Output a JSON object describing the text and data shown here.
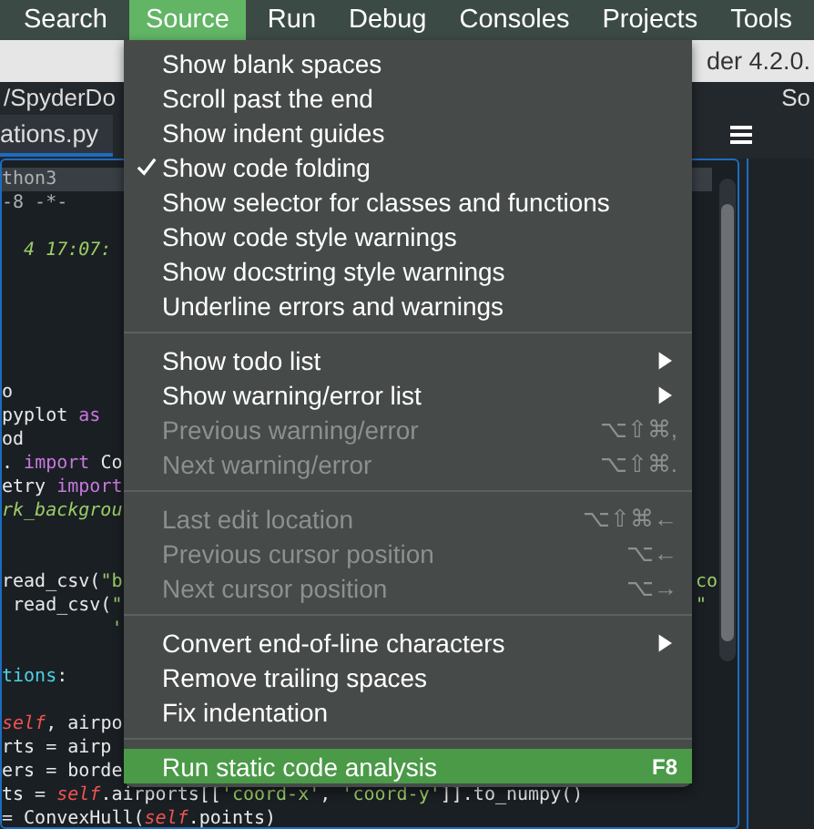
{
  "menubar": [
    {
      "label": "Search",
      "selected": false
    },
    {
      "label": "Source",
      "selected": true
    },
    {
      "label": "Run",
      "selected": false
    },
    {
      "label": "Debug",
      "selected": false
    },
    {
      "label": "Consoles",
      "selected": false
    },
    {
      "label": "Projects",
      "selected": false
    },
    {
      "label": "Tools",
      "selected": false
    }
  ],
  "window": {
    "title": "der 4.2.0."
  },
  "path_bar": {
    "path": "/SpyderDo",
    "right_pane_title": "So"
  },
  "editor_tab": {
    "label": "ations.py",
    "selected": true
  },
  "code_lines": [
    {
      "kind": "current",
      "segments": [
        {
          "kind": "comment",
          "text": "thon3"
        }
      ]
    },
    {
      "kind": "code",
      "segments": [
        {
          "kind": "comment",
          "text": "-8 -*-"
        }
      ]
    },
    {
      "kind": "blank"
    },
    {
      "kind": "code",
      "segments": [
        {
          "kind": "docstring",
          "text": "  4 17:07:"
        }
      ]
    },
    {
      "kind": "blank"
    },
    {
      "kind": "blank"
    },
    {
      "kind": "blank"
    },
    {
      "kind": "blank"
    },
    {
      "kind": "blank"
    },
    {
      "kind": "code",
      "segments": [
        {
          "kind": "plain",
          "text": "o"
        }
      ]
    },
    {
      "kind": "code",
      "segments": [
        {
          "kind": "plain",
          "text": "pyplot "
        },
        {
          "kind": "keyword",
          "text": "as"
        }
      ]
    },
    {
      "kind": "code",
      "segments": [
        {
          "kind": "plain",
          "text": "od"
        }
      ]
    },
    {
      "kind": "code",
      "segments": [
        {
          "kind": "plain",
          "text": ". "
        },
        {
          "kind": "keyword",
          "text": "import"
        },
        {
          "kind": "plain",
          "text": " Co"
        }
      ]
    },
    {
      "kind": "code",
      "segments": [
        {
          "kind": "plain",
          "text": "etry "
        },
        {
          "kind": "keyword",
          "text": "import"
        }
      ]
    },
    {
      "kind": "code",
      "segments": [
        {
          "kind": "docstring",
          "text": "rk_backgrou"
        }
      ]
    },
    {
      "kind": "blank"
    },
    {
      "kind": "blank"
    },
    {
      "kind": "code",
      "segments": [
        {
          "kind": "plain",
          "text": "read_csv("
        },
        {
          "kind": "string",
          "text": "\"b"
        }
      ],
      "tail": {
        "kind": "string",
        "text": "co"
      }
    },
    {
      "kind": "code",
      "segments": [
        {
          "kind": "plain",
          "text": " read_csv("
        },
        {
          "kind": "string",
          "text": "\""
        }
      ],
      "tail": {
        "kind": "string",
        "text": "\""
      }
    },
    {
      "kind": "code",
      "segments": [
        {
          "kind": "string",
          "text": "          '"
        }
      ]
    },
    {
      "kind": "blank"
    },
    {
      "kind": "code",
      "segments": [
        {
          "kind": "name",
          "text": "tions"
        },
        {
          "kind": "plain",
          "text": ":"
        }
      ]
    },
    {
      "kind": "blank"
    },
    {
      "kind": "code",
      "segments": [
        {
          "kind": "self",
          "text": "self"
        },
        {
          "kind": "plain",
          "text": ", airpo"
        }
      ]
    },
    {
      "kind": "code",
      "segments": [
        {
          "kind": "plain",
          "text": "rts = airp"
        }
      ]
    },
    {
      "kind": "code",
      "segments": [
        {
          "kind": "plain",
          "text": "ers = borde"
        }
      ]
    },
    {
      "kind": "code",
      "segments": [
        {
          "kind": "plain",
          "text": "ts = "
        },
        {
          "kind": "self",
          "text": "self"
        },
        {
          "kind": "plain",
          "text": ".airports[["
        },
        {
          "kind": "string",
          "text": "'coord-x'"
        },
        {
          "kind": "plain",
          "text": ", "
        },
        {
          "kind": "string",
          "text": "'coord-y'"
        },
        {
          "kind": "plain",
          "text": "]].to_numpy()"
        }
      ]
    },
    {
      "kind": "code",
      "segments": [
        {
          "kind": "plain",
          "text": "= ConvexHull("
        },
        {
          "kind": "self",
          "text": "self"
        },
        {
          "kind": "plain",
          "text": ".points)"
        }
      ]
    }
  ],
  "menu": {
    "sections": [
      [
        {
          "label": "Show blank spaces",
          "checked": false
        },
        {
          "label": "Scroll past the end",
          "checked": false
        },
        {
          "label": "Show indent guides",
          "checked": false
        },
        {
          "label": "Show code folding",
          "checked": true
        },
        {
          "label": "Show selector for classes and functions",
          "checked": false
        },
        {
          "label": "Show code style warnings",
          "checked": false
        },
        {
          "label": "Show docstring style warnings",
          "checked": false
        },
        {
          "label": "Underline errors and warnings",
          "checked": false
        }
      ],
      [
        {
          "label": "Show todo list",
          "submenu": true
        },
        {
          "label": "Show warning/error list",
          "submenu": true
        },
        {
          "label": "Previous warning/error",
          "disabled": true,
          "shortcut": "⌥⇧⌘,"
        },
        {
          "label": "Next warning/error",
          "disabled": true,
          "shortcut": "⌥⇧⌘."
        }
      ],
      [
        {
          "label": "Last edit location",
          "disabled": true,
          "shortcut": "⌥⇧⌘←"
        },
        {
          "label": "Previous cursor position",
          "disabled": true,
          "shortcut": "⌥←"
        },
        {
          "label": "Next cursor position",
          "disabled": true,
          "shortcut": "⌥→"
        }
      ],
      [
        {
          "label": "Convert end-of-line characters",
          "submenu": true
        },
        {
          "label": "Remove trailing spaces"
        },
        {
          "label": "Fix indentation"
        }
      ],
      [
        {
          "label": "Run static code analysis",
          "highlighted": true,
          "shortcut": "F8"
        }
      ]
    ]
  }
}
